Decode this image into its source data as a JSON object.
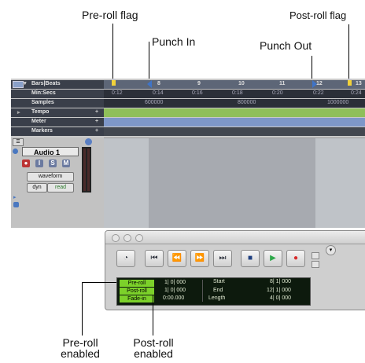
{
  "callouts": {
    "preroll_flag": "Pre-roll flag",
    "postroll_flag": "Post-roll flag",
    "punch_in": "Punch In",
    "punch_out": "Punch Out",
    "preroll_enabled": [
      "Pre-roll",
      "enabled"
    ],
    "postroll_enabled": [
      "Post-roll",
      "enabled"
    ]
  },
  "rulers": {
    "bars_beats": {
      "label": "Bars|Beats",
      "ticks": [
        "8",
        "9",
        "10",
        "11",
        "12",
        "13"
      ]
    },
    "min_secs": {
      "label": "Min:Secs",
      "ticks": [
        "0:12",
        "0:14",
        "0:16",
        "0:18",
        "0:20",
        "0:22",
        "0:24"
      ]
    },
    "samples": {
      "label": "Samples",
      "ticks": [
        "600000",
        "800000",
        "1000000"
      ]
    },
    "tempo": {
      "label": "Tempo"
    },
    "meter": {
      "label": "Meter"
    },
    "markers": {
      "label": "Markers"
    }
  },
  "track": {
    "name": "Audio 1",
    "buttons": {
      "record": "●",
      "input": "I",
      "solo": "S",
      "mute": "M"
    },
    "view": "waveform",
    "mode_left": "dyn",
    "mode_right": "read"
  },
  "transport": {
    "buttons": [
      "online",
      "return-to-zero",
      "rewind",
      "fast-forward",
      "go-to-end",
      "stop",
      "play",
      "record"
    ],
    "labels": {
      "preroll": "Pre-roll",
      "postroll": "Post-roll",
      "fadein": "Fade-in"
    },
    "values": {
      "preroll": "1| 0| 000",
      "postroll": "1| 0| 000",
      "fadein": "0:00.000"
    },
    "range": {
      "start_label": "Start",
      "start": "8| 1| 000",
      "end_label": "End",
      "end": "12| 1| 000",
      "length_label": "Length",
      "length": "4| 0| 000"
    }
  },
  "colors": {
    "flag_yellow": "#f2d23a",
    "punch_blue": "#3f74c7",
    "tempo_green": "#8fbf5a",
    "meter_blue": "#7e97c8",
    "play_green": "#2ea84a",
    "record_red": "#d82c2c",
    "enabled_green": "#7cd12a"
  }
}
